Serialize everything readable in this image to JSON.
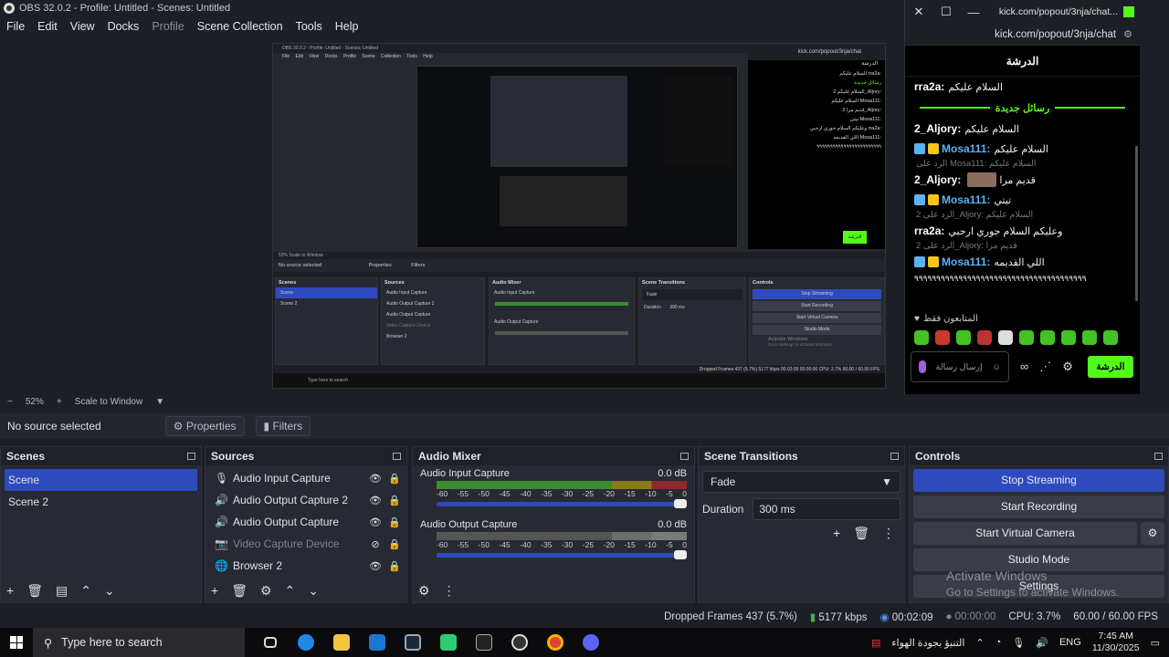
{
  "window": {
    "title": "OBS 32.0.2 - Profile: Untitled - Scenes: Untitled"
  },
  "menu": [
    "File",
    "Edit",
    "View",
    "Docks",
    "Profile",
    "Scene Collection",
    "Tools",
    "Help"
  ],
  "mini": {
    "title": "OBS 32.0.2 - Profile: Untitled - Scenes: Untitled",
    "menu": "File Edit View Docks Profile Scene Collection Tools Help",
    "source_label": "No source selected",
    "properties": "Properties",
    "filters": "Filters",
    "scenes_h": "Scenes",
    "scene1": "Scene",
    "scene2": "Scene 2",
    "sources_h": "Sources",
    "src": [
      "Audio Input Capture",
      "Audio Output Capture 2",
      "Audio Output Capture",
      "Video Capture Device",
      "Browser 2"
    ],
    "mixer_h": "Audio Mixer",
    "mix1": "Audio Input Capture",
    "mix2": "Audio Output Capture",
    "trans_h": "Scene Transitions",
    "fade": "Fade",
    "duration": "Duration",
    "dur_val": "300 ms",
    "controls_h": "Controls",
    "ctl": [
      "Stop Streaming",
      "Start Recording",
      "Start Virtual Camera",
      "Studio Mode"
    ],
    "activate": "Activate Windows",
    "goto": "Go to Settings to activate Windows.",
    "status": "Dropped Frames 437 (5.7%)   5177 kbps   00:02:09   00:00:00   CPU: 3.7%   60.00 / 60.00 FPS",
    "search": "Type here to search",
    "zoom": "52%   Scale to Window",
    "chat_url": "kick.com/popout/3nja/chat",
    "chat_head": "الدرشة",
    "chat_lines": [
      "السلام عليكم rra2a:",
      "رسائل جديدة",
      "السلام عليكم 2_Aljory:",
      "السلام عليكم Mosa111:",
      "قديم مرا 2_Aljory:",
      "تيتي Mosa111:",
      "وعليكم السلام جوري ارحبي rra2a:",
      "اللي القديمه Mosa111:",
      "٩٩٩٩٩٩٩٩٩٩٩٩٩٩٩٩٩٩٩٩٩٩٩٩"
    ],
    "chat_btn": "الدرشة"
  },
  "chat": {
    "tab_title": "kick.com/popout/3nja/chat...",
    "url": "kick.com/popout/3nja/chat",
    "header": "الدرشة",
    "messages": [
      {
        "user": "rra2a:",
        "text": "السلام عليكم",
        "color": "#ffffff",
        "badges": []
      },
      {
        "user": "2_Aljory:",
        "text": "السلام عليكم",
        "color": "#ffffff",
        "badges": []
      },
      {
        "user": "Mosa111:",
        "text": "السلام عليكم",
        "color": "#5bb4f0",
        "badges": [
          "blue",
          "gold"
        ]
      },
      {
        "reply": "الرد على Mosa111: السلام عليكم",
        "user": "2_Aljory:",
        "text": "قديم مرا",
        "color": "#ffffff",
        "emote": true,
        "badges": []
      },
      {
        "user": "Mosa111:",
        "text": "تيتي",
        "color": "#5bb4f0",
        "badges": [
          "blue",
          "gold"
        ]
      },
      {
        "reply": "الرد على 2_Aljory: السلام عليكم",
        "user": "rra2a:",
        "text": "وعليكم السلام جوري ارحبي",
        "color": "#ffffff",
        "badges": []
      },
      {
        "reply": "الرد على 2_Aljory: قديم مرا",
        "user": "Mosa111:",
        "text": "اللي القديمه",
        "color": "#5bb4f0",
        "badges": [
          "blue",
          "gold"
        ]
      }
    ],
    "new_messages": "رسائل جديدة",
    "spam": "٩٩٩٩٩٩٩٩٩٩٩٩٩٩٩٩٩٩٩٩٩٩٩٩٩٩٩٩٩٩٩٩٩٩٩٩٩٩٩",
    "subs_only": "المتابعون فقط",
    "input_placeholder": "إرسال رسالة",
    "send": "الدرشة",
    "accent": "#53fc18"
  },
  "zoom": {
    "value": "52%",
    "mode": "Scale to Window"
  },
  "source_bar": {
    "label": "No source selected",
    "properties": "Properties",
    "filters": "Filters"
  },
  "scenes": {
    "title": "Scenes",
    "items": [
      "Scene",
      "Scene 2"
    ]
  },
  "sources": {
    "title": "Sources",
    "items": [
      {
        "name": "Audio Input Capture",
        "icon": "mic-icon",
        "dim": false
      },
      {
        "name": "Audio Output Capture 2",
        "icon": "speaker-icon",
        "dim": false
      },
      {
        "name": "Audio Output Capture",
        "icon": "speaker-icon",
        "dim": false
      },
      {
        "name": "Video Capture Device",
        "icon": "camera-icon",
        "dim": true
      },
      {
        "name": "Browser 2",
        "icon": "globe-icon",
        "dim": false
      }
    ]
  },
  "mixer": {
    "title": "Audio Mixer",
    "channels": [
      {
        "name": "Audio Input Capture",
        "db": "0.0 dB"
      },
      {
        "name": "Audio Output Capture",
        "db": "0.0 dB"
      }
    ],
    "scale": [
      "-60",
      "-55",
      "-50",
      "-45",
      "-40",
      "-35",
      "-30",
      "-25",
      "-20",
      "-15",
      "-10",
      "-5",
      "0"
    ]
  },
  "transitions": {
    "title": "Scene Transitions",
    "selected": "Fade",
    "duration_label": "Duration",
    "duration": "300 ms"
  },
  "controls": {
    "title": "Controls",
    "buttons": [
      "Stop Streaming",
      "Start Recording",
      "Start Virtual Camera",
      "Studio Mode",
      "Settings"
    ]
  },
  "watermark": {
    "title": "Activate Windows",
    "sub": "Go to Settings to activate Windows."
  },
  "status": {
    "dropped": "Dropped Frames 437 (5.7%)",
    "kbps": "5177 kbps",
    "stream_time": "00:02:09",
    "rec_time": "00:00:00",
    "cpu": "CPU: 3.7%",
    "fps": "60.00 / 60.00 FPS"
  },
  "taskbar": {
    "search": "Type here to search",
    "weather": "التنبؤ بجودة الهواء",
    "lang": "ENG",
    "time": "7:45 AM",
    "date": "11/30/2025"
  }
}
